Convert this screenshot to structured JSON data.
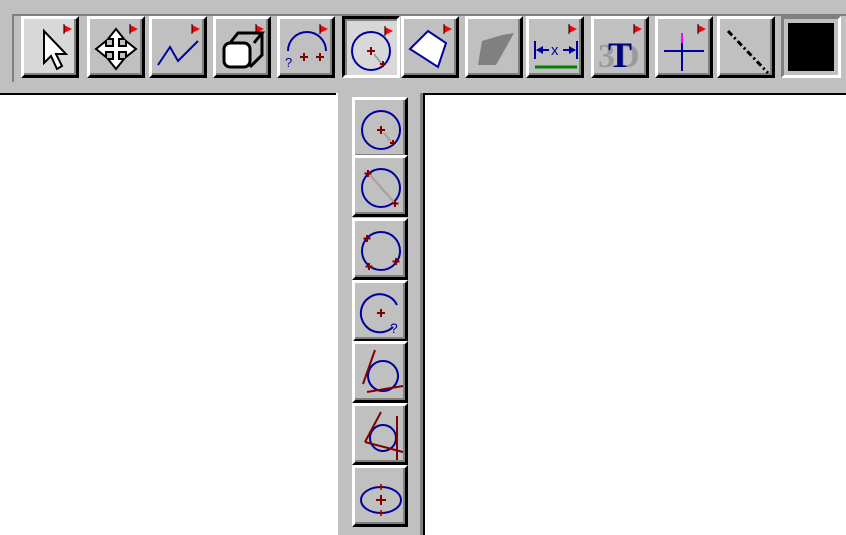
{
  "toolbar": {
    "buttons": [
      {
        "id": "select",
        "icon": "arrow-pointer-icon",
        "has_flyout": true,
        "pressed": false
      },
      {
        "id": "move",
        "icon": "move-arrows-icon",
        "has_flyout": true,
        "pressed": false
      },
      {
        "id": "polyline",
        "icon": "polyline-icon",
        "has_flyout": true,
        "pressed": false
      },
      {
        "id": "box3d",
        "icon": "3d-box-icon",
        "has_flyout": true,
        "pressed": false
      },
      {
        "id": "arc",
        "icon": "arc-icon",
        "has_flyout": true,
        "pressed": false
      },
      {
        "id": "circle",
        "icon": "circle-icon",
        "has_flyout": true,
        "pressed": true
      },
      {
        "id": "polygon",
        "icon": "polygon-icon",
        "has_flyout": true,
        "pressed": false
      },
      {
        "id": "hatch",
        "icon": "hatch-shape-icon",
        "has_flyout": false,
        "pressed": false
      },
      {
        "id": "dimension",
        "icon": "dimension-icon",
        "has_flyout": true,
        "pressed": false,
        "label": "x"
      },
      {
        "id": "text3d",
        "icon": "3d-text-icon",
        "has_flyout": true,
        "pressed": false,
        "label_back": "3D",
        "label_front": "T"
      },
      {
        "id": "crosshair",
        "icon": "crosshair-icon",
        "has_flyout": true,
        "pressed": false
      },
      {
        "id": "linestyle",
        "icon": "dashed-line-icon",
        "has_flyout": false,
        "pressed": false
      }
    ],
    "current_color": "#000000"
  },
  "circle_flyout": {
    "items": [
      {
        "id": "center-radius",
        "icon": "circle-center-radius-icon"
      },
      {
        "id": "two-point",
        "icon": "circle-two-point-icon"
      },
      {
        "id": "three-point",
        "icon": "circle-three-point-icon"
      },
      {
        "id": "center-unknown",
        "icon": "circle-center-question-icon",
        "label": "?"
      },
      {
        "id": "tangent-two",
        "icon": "circle-tangent-two-icon"
      },
      {
        "id": "tangent-three",
        "icon": "circle-tangent-three-icon"
      },
      {
        "id": "ellipse",
        "icon": "ellipse-icon"
      }
    ]
  },
  "colors": {
    "face": "#c0c0c0",
    "shape_blue": "#0000a0",
    "marker_red": "#800000",
    "flag_red": "#ff0000",
    "green": "#008000",
    "magenta": "#ff00ff"
  }
}
